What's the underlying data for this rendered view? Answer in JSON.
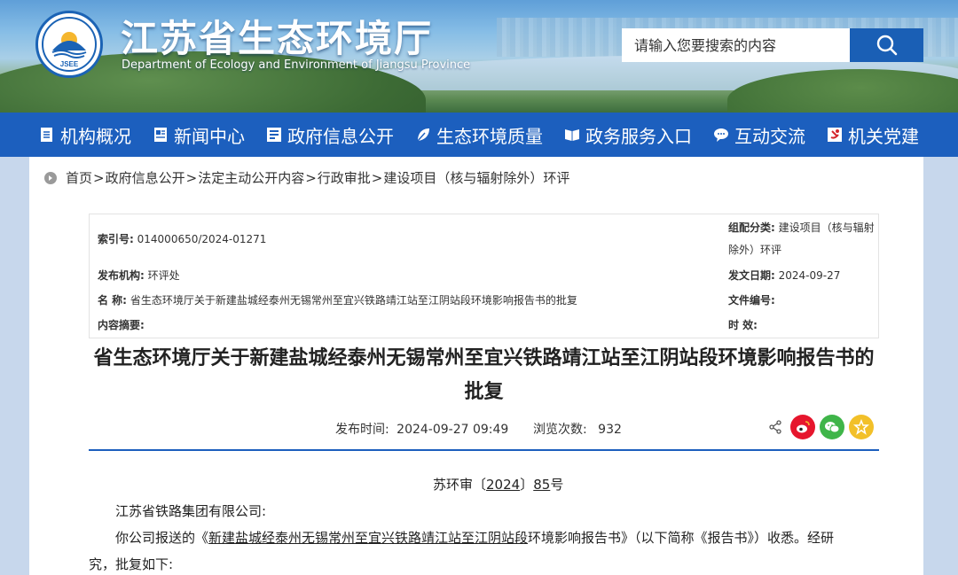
{
  "header": {
    "title": "江苏省生态环境厅",
    "subtitle": "Department of Ecology and Environment of Jiangsu Province",
    "logo_text": "JSEE",
    "search_placeholder": "请输入您要搜索的内容"
  },
  "nav": {
    "items": [
      {
        "label": "机构概况",
        "icon": "document-icon"
      },
      {
        "label": "新闻中心",
        "icon": "newspaper-icon"
      },
      {
        "label": "政府信息公开",
        "icon": "info-list-icon"
      },
      {
        "label": "生态环境质量",
        "icon": "leaf-icon"
      },
      {
        "label": "政务服务入口",
        "icon": "open-book-icon"
      },
      {
        "label": "互动交流",
        "icon": "chat-bubble-icon"
      },
      {
        "label": "机关党建",
        "icon": "party-emblem-icon"
      }
    ]
  },
  "breadcrumb": {
    "items": [
      "首页",
      "政府信息公开",
      "法定主动公开内容",
      "行政审批",
      "建设项目（核与辐射除外）环评"
    ],
    "separator": ">"
  },
  "info": {
    "index_label": "索引号:",
    "index_value": "014000650/2024-01271",
    "category_label": "组配分类:",
    "category_value_line1": "建设项目（核与辐射",
    "category_value_line2": "除外）环评",
    "publisher_label": "发布机构:",
    "publisher_value": "环评处",
    "date_label": "发文日期:",
    "date_value": "2024-09-27",
    "name_label": "名 称:",
    "name_value": "省生态环境厅关于新建盐城经泰州无锡常州至宜兴铁路靖江站至江阴站段环境影响报告书的批复",
    "docno_label": "文件编号:",
    "docno_value": "",
    "summary_label": "内容摘要:",
    "summary_value": "",
    "validity_label": "时 效:",
    "validity_value": ""
  },
  "article": {
    "title_line1": "省生态环境厅关于新建盐城经泰州无锡常州至宜兴铁路靖江站至江阴站段环境影响报告书的",
    "title_line2": "批复",
    "publish_label": "发布时间:",
    "publish_value": "2024-09-27 09:49",
    "views_label": "浏览次数:",
    "views_value": "932",
    "doc_number_prefix": "苏环审〔",
    "doc_number_year": "2024",
    "doc_number_mid": "〕",
    "doc_number_num": "85",
    "doc_number_suffix": "号",
    "addressee": "江苏省铁路集团有限公司:",
    "para1_a": "你公司报送的《",
    "para1_link": "新建盐城经泰州无锡常州至宜兴铁路靖江站至江阴站段",
    "para1_b": "环境影响报告书》（以下简称《报告书》）收悉。经研",
    "para1_c": "究，批复如下:"
  },
  "colors": {
    "nav_bg": "#1c5fbe",
    "accent": "#1a5fb5",
    "weibo": "#e6162d",
    "wechat": "#3fb549",
    "favorite": "#f2c029"
  }
}
